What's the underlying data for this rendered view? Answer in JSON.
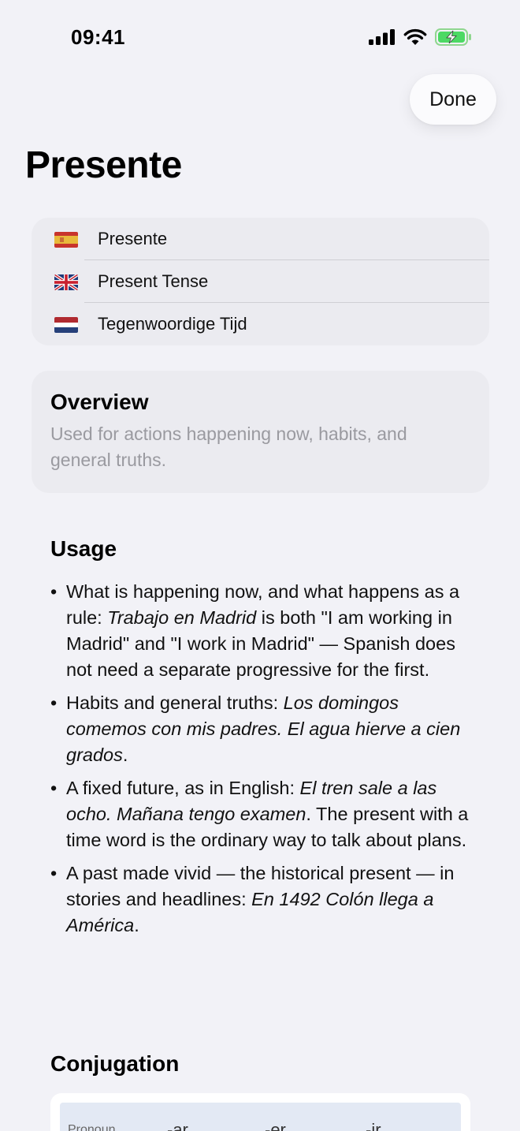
{
  "status": {
    "time": "09:41"
  },
  "nav": {
    "done_label": "Done"
  },
  "title": "Presente",
  "languages": [
    {
      "flag": "spain-flag-icon",
      "label": "Presente"
    },
    {
      "flag": "uk-flag-icon",
      "label": "Present Tense"
    },
    {
      "flag": "netherlands-flag-icon",
      "label": "Tegenwoordige Tijd"
    }
  ],
  "overview": {
    "title": "Overview",
    "text": "Used for actions happening now, habits, and general truths."
  },
  "usage": {
    "title": "Usage",
    "items": [
      {
        "a": "What is happening now, and what happens as a rule: ",
        "b": "Trabajo en Madrid",
        "c": " is both \"I am working in Madrid\" and \"I work in Madrid\" — Spanish does not need a separate progressive for the first."
      },
      {
        "a": "Habits and general truths: ",
        "b": "Los domingos comemos con mis padres. El agua hierve a cien grados",
        "c": "."
      },
      {
        "a": "A fixed future, as in English: ",
        "b": "El tren sale a las ocho. Mañana tengo examen",
        "c": ". The present with a time word is the ordinary way to talk about plans."
      },
      {
        "a": "A past made vivid — the historical present — in stories and headlines: ",
        "b": "En 1492 Colón llega a América",
        "c": "."
      }
    ]
  },
  "conjugation": {
    "title": "Conjugation",
    "header": {
      "pronoun": "Pronoun",
      "ar": "-ar",
      "er": "-er",
      "ir": "-ir"
    }
  }
}
